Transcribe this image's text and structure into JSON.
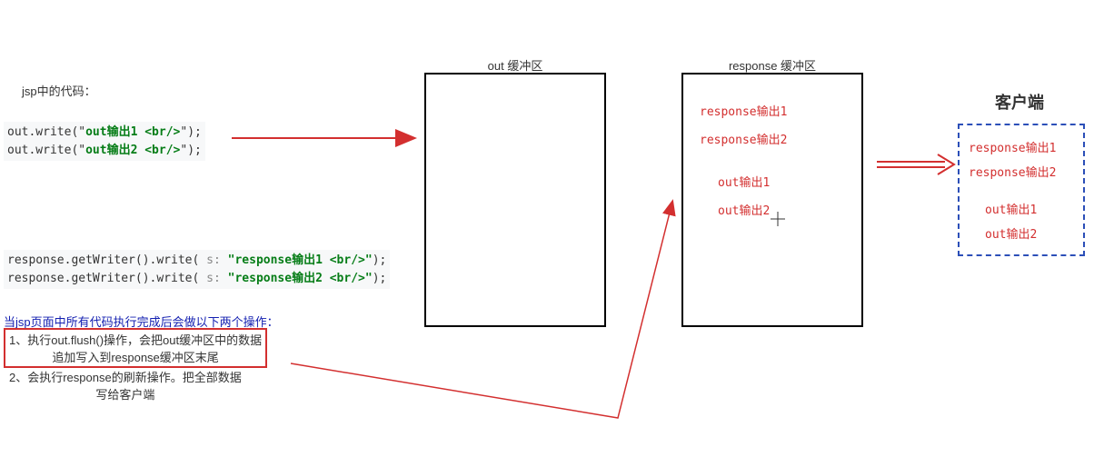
{
  "section_title": "jsp中的代码：",
  "code1": {
    "line1_prefix": "out.write(\"",
    "line1_bold": "out输出1 <br/>",
    "line1_suffix": "\");",
    "line2_prefix": "out.write(\"",
    "line2_bold": "out输出2 <br/>",
    "line2_suffix": "\");"
  },
  "code2": {
    "line1_p1": "response.getWriter().write(",
    "line1_hint": " s: ",
    "line1_str": "\"response输出1 <br/>\"",
    "line1_p2": ");",
    "line2_p1": "response.getWriter().write(",
    "line2_hint": " s: ",
    "line2_str": "\"response输出2 <br/>\"",
    "line2_p2": ");"
  },
  "note_intro": "当jsp页面中所有代码执行完成后会做以下两个操作：",
  "note1_l1": "1、执行out.flush()操作，会把out缓冲区中的数据",
  "note1_l2": "追加写入到response缓冲区末尾",
  "note2_l1": "2、会执行response的刷新操作。把全部数据",
  "note2_l2": "写给客户端",
  "out_buffer_title": "out 缓冲区",
  "response_buffer_title": "response 缓冲区",
  "resp_line1": "response输出1",
  "resp_line2": "response输出2",
  "resp_line3": "out输出1",
  "resp_line4": "out输出2",
  "client_title": "客户端",
  "client_line1": "response输出1",
  "client_line2": "response输出2",
  "client_line3": "out输出1",
  "client_line4": "out输出2"
}
